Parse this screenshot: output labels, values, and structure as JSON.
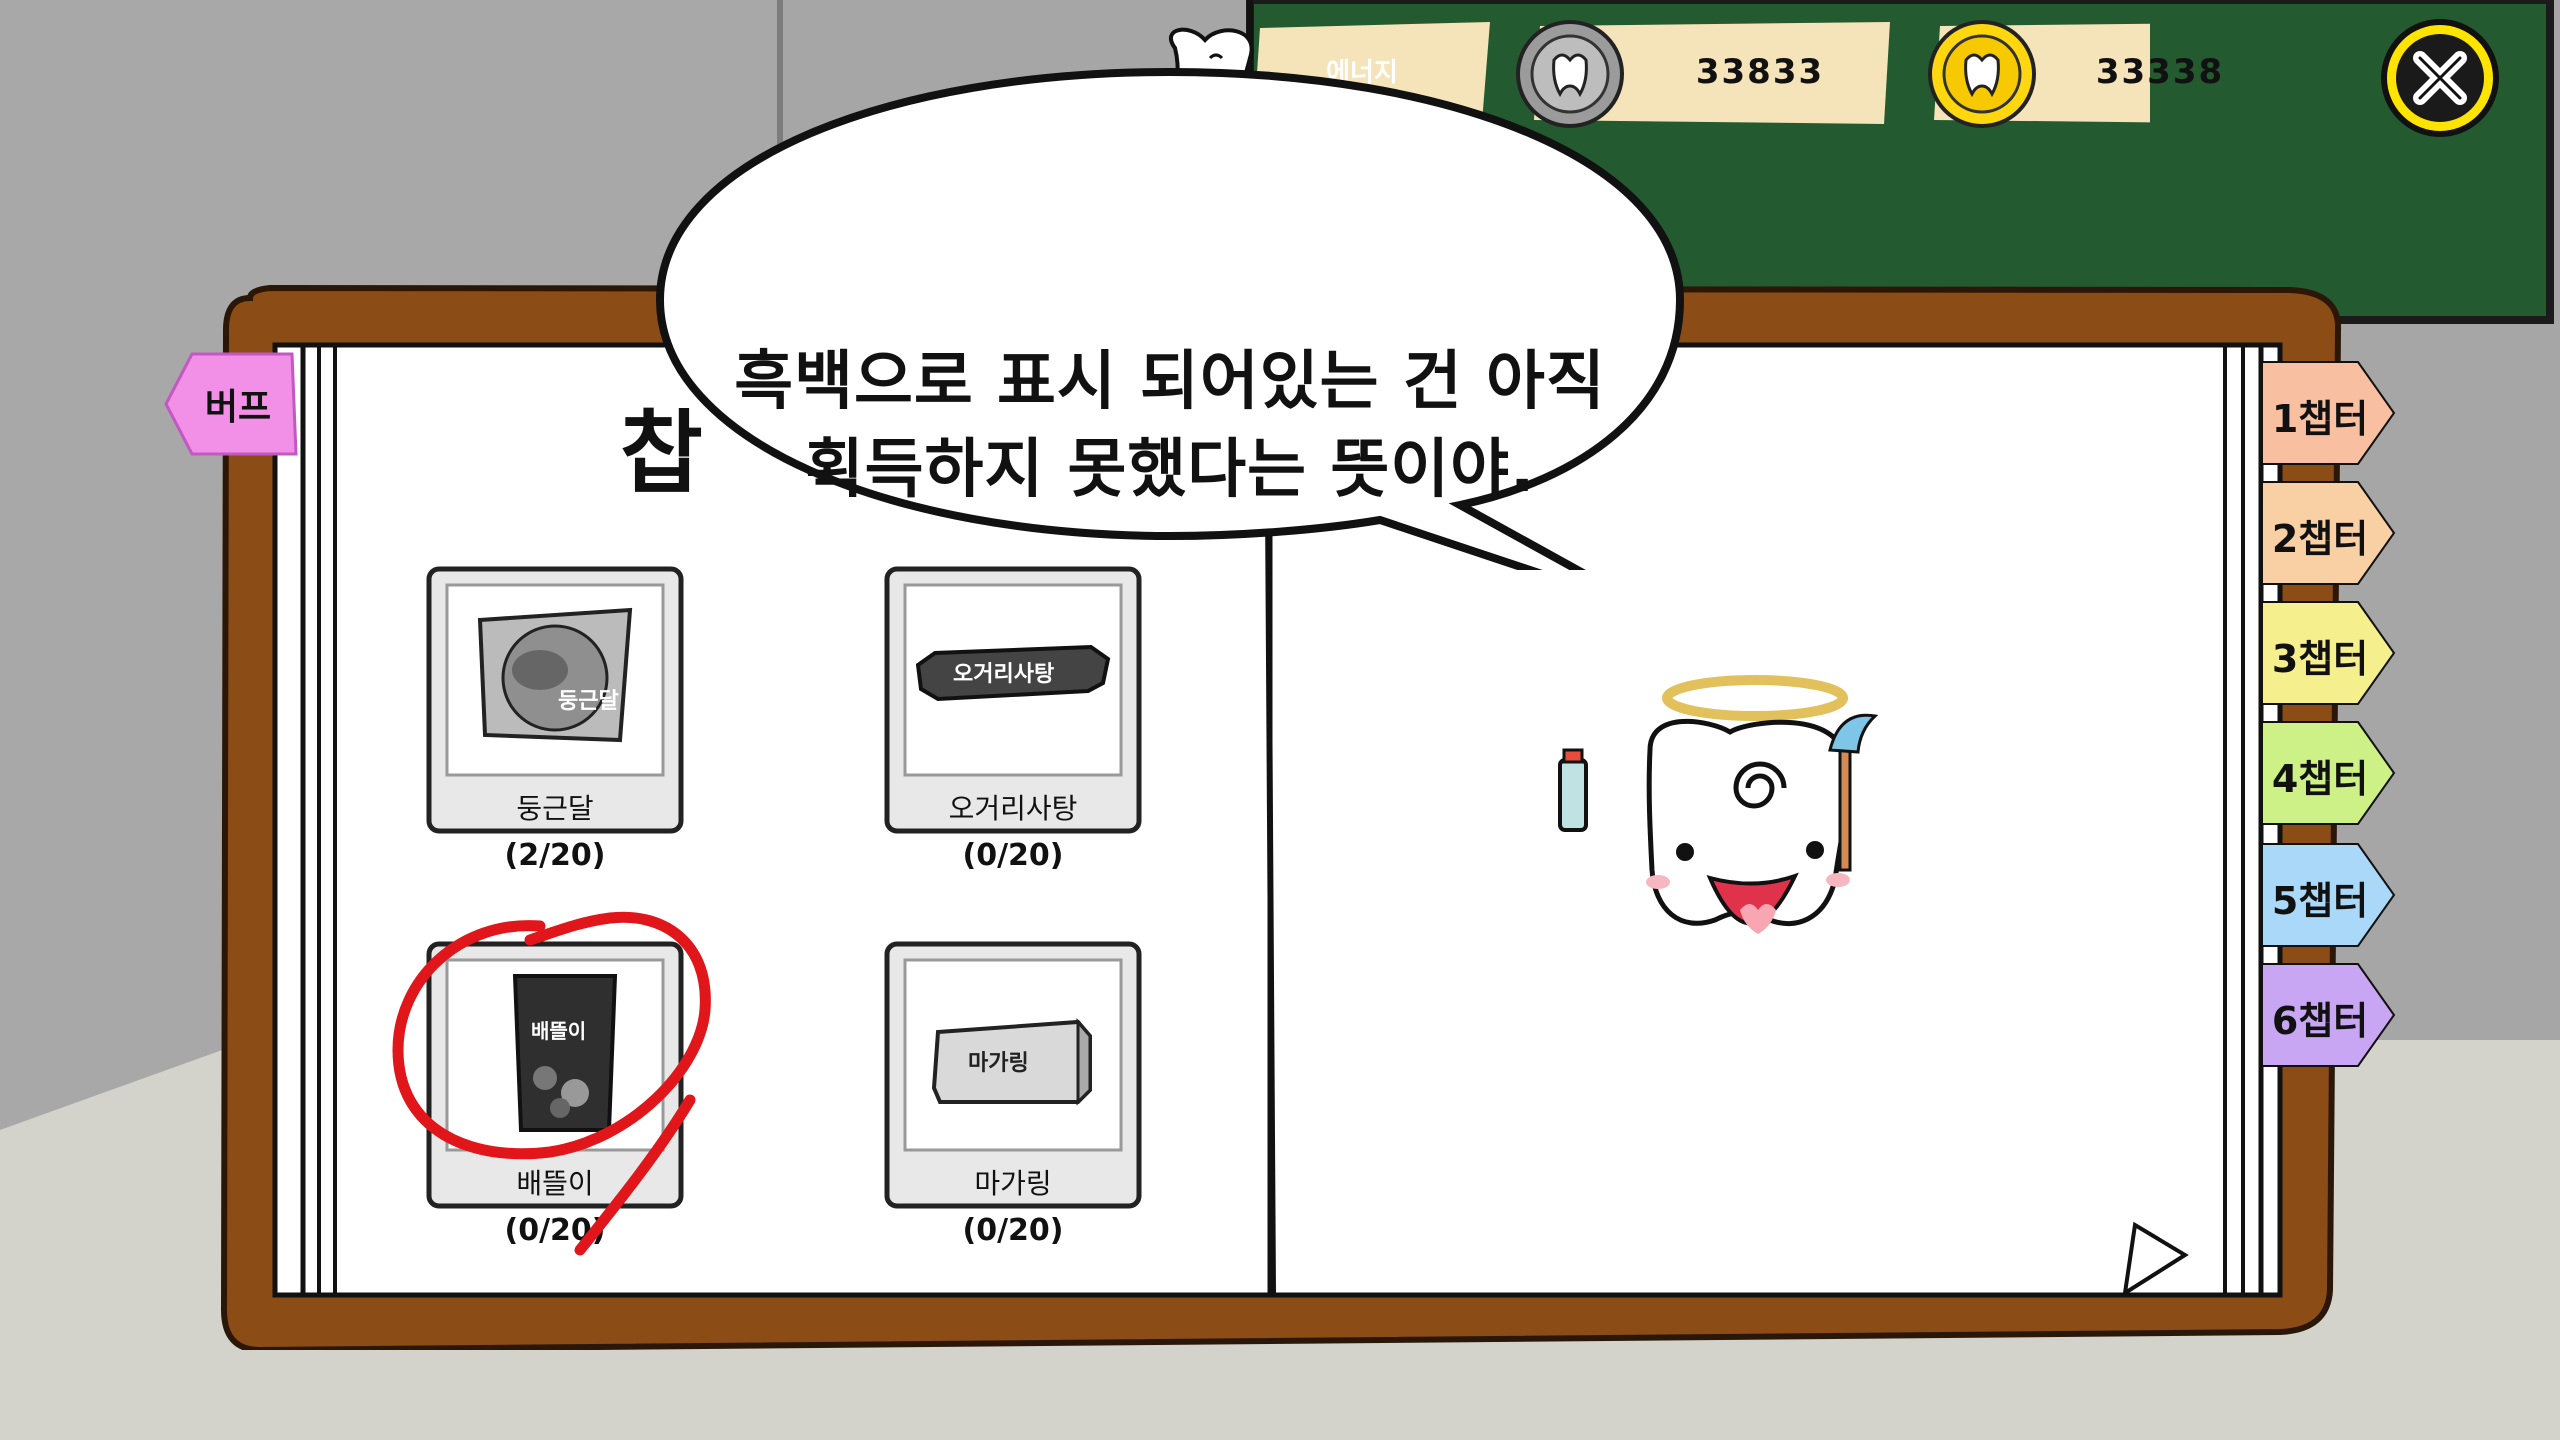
{
  "hud": {
    "energy_label": "에너지",
    "silver_coins": "33833",
    "gold_coins": "33338",
    "icons": {
      "mascot": "tooth-mascot-icon",
      "silver": "silver-tooth-coin-icon",
      "gold": "gold-tooth-coin-icon",
      "close": "close-icon"
    }
  },
  "speech": {
    "line1": "흑백으로 표시 되어있는 건 아직",
    "line2": "획득하지 못했다는 뜻이야."
  },
  "book": {
    "title_partial": "찹",
    "buff_tab": "버프",
    "chapter_tabs": [
      {
        "label": "1챕터",
        "color": "#f8bfa0"
      },
      {
        "label": "2챕터",
        "color": "#f9cfa4"
      },
      {
        "label": "3챕터",
        "color": "#f6ef8d"
      },
      {
        "label": "4챕터",
        "color": "#cdf187"
      },
      {
        "label": "5챕터",
        "color": "#a9d8f8"
      },
      {
        "label": "6챕터",
        "color": "#c8a6f4"
      }
    ],
    "items": [
      {
        "name": "둥근달",
        "progress": "(2/20)",
        "pack_text": "둥근달"
      },
      {
        "name": "오거리사탕",
        "progress": "(0/20)",
        "pack_text": "오거리사탕"
      },
      {
        "name": "배뜰이",
        "progress": "(0/20)",
        "pack_text": "배뜰이"
      },
      {
        "name": "마가링",
        "progress": "(0/20)",
        "pack_text": "마가링"
      }
    ]
  }
}
